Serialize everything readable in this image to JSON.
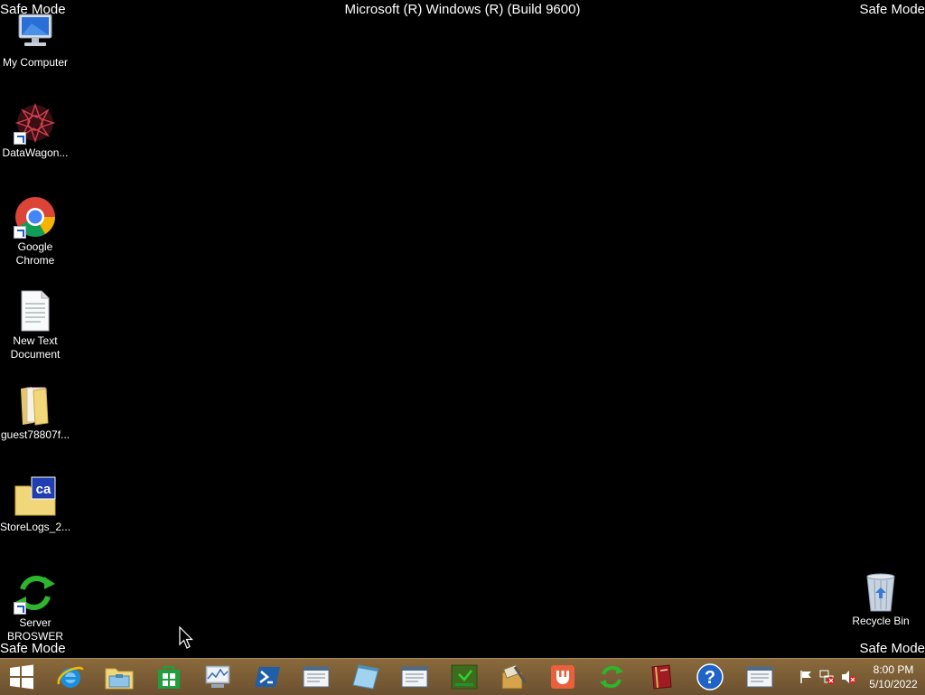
{
  "overlay": {
    "safe_mode": "Safe Mode",
    "build_text": "Microsoft (R) Windows (R) (Build 9600)"
  },
  "desktop_icons": [
    {
      "label": "My Computer",
      "icon": "my-computer-icon"
    },
    {
      "label": "DataWagon...",
      "icon": "datawagon-icon"
    },
    {
      "label": "Google Chrome",
      "icon": "chrome-icon"
    },
    {
      "label": "New Text Document",
      "icon": "text-document-icon"
    },
    {
      "label": "guest78807f...",
      "icon": "folder-icon"
    },
    {
      "label": "StoreLogs_2...",
      "icon": "storelogs-icon"
    },
    {
      "label": "Server BROSWER",
      "icon": "server-browser-icon"
    },
    {
      "label": "Recycle Bin",
      "icon": "recycle-bin-icon"
    }
  ],
  "taskbar": {
    "items": [
      "start-button",
      "internet-explorer-icon",
      "file-explorer-icon",
      "store-icon",
      "performance-monitor-icon",
      "powershell-icon",
      "window-app-icon",
      "notepad-icon",
      "window-app-icon",
      "green-app-icon",
      "tools-icon",
      "orange-app-icon",
      "sync-icon",
      "book-icon",
      "help-icon",
      "window-app-icon"
    ],
    "tray_icons": [
      "flag-icon",
      "network-error-icon",
      "volume-muted-icon"
    ],
    "time": "8:00 PM",
    "date": "5/10/2022"
  },
  "colors": {
    "desktop_background": "#000000",
    "taskbar": "#7a5c35"
  }
}
